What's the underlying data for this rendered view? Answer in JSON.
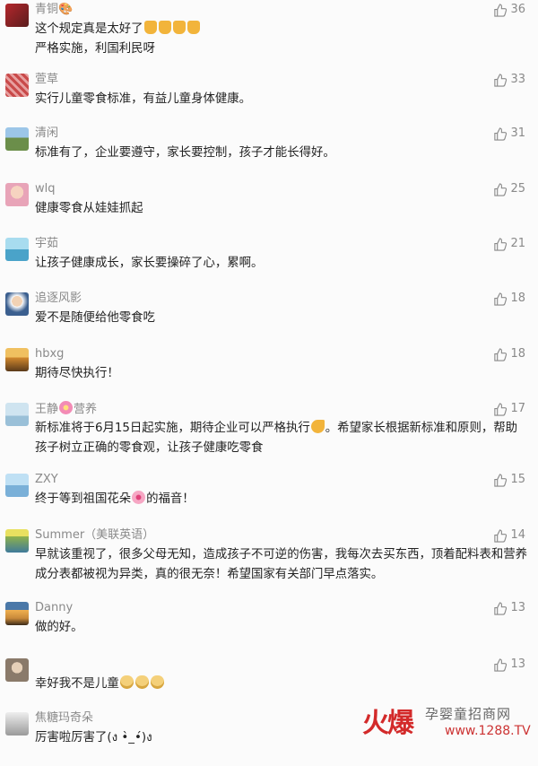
{
  "comments": [
    {
      "name": "青铜🎨",
      "text": "这个规定真是太好了",
      "emojis_after": [
        "thumbs-up-icon",
        "thumbs-up-icon",
        "thumbs-up-icon",
        "thumbs-up-icon"
      ],
      "text2": "严格实施，利国利民呀",
      "likes": "36",
      "avatar_color": "#b5272c"
    },
    {
      "name": "萱草",
      "text": "实行儿童零食标准，有益儿童身体健康。",
      "likes": "33",
      "avatar_color": "#c94a4a"
    },
    {
      "name": "清闲",
      "text": "标准有了，企业要遵守，家长要控制，孩子才能长得好。",
      "likes": "31",
      "avatar_color": "#6b8e4a"
    },
    {
      "name": "wlq",
      "text": "健康零食从娃娃抓起",
      "likes": "25",
      "avatar_color": "#e8a4b8"
    },
    {
      "name": "宇茹",
      "text": "让孩子健康成长，家长要操碎了心，累啊。",
      "likes": "21",
      "avatar_color": "#4aa3c9"
    },
    {
      "name": "追逐风影",
      "text": "爱不是随便给他零食吃",
      "likes": "18",
      "avatar_color": "#3b5f8f"
    },
    {
      "name": "hbxg",
      "text": "期待尽快执行！",
      "likes": "18",
      "avatar_color": "#d48a2e"
    },
    {
      "name": "王静",
      "name_suffix": "营养",
      "text": "新标准将于6月15日起实施，期待企业可以严格执行",
      "text2": "。希望家长根据新标准和原则，帮助孩子树立正确的零食观，让孩子健康吃零食",
      "likes": "17",
      "avatar_color": "#9ac0d8"
    },
    {
      "name": "ZXY",
      "text": "终于等到祖国花朵",
      "text2": "的福音！",
      "likes": "15",
      "avatar_color": "#7ab0d8"
    },
    {
      "name": "Summer（美联英语）",
      "text": "早就该重视了，很多父母无知，造成孩子不可逆的伤害，我每次去买东西，顶着配料表和营养成分表都被视为异类，真的很无奈！希望国家有关部门早点落实。",
      "likes": "14",
      "avatar_color": "#8fb24a"
    },
    {
      "name": "Danny",
      "text": "做的好。",
      "likes": "13",
      "avatar_color": "#c98a3a"
    },
    {
      "name": "",
      "text": "幸好我不是儿童",
      "likes": "13",
      "avatar_color": "#8a7a6a"
    },
    {
      "name": "焦糖玛奇朵",
      "text": "厉害啦厉害了(ง •̀_•́)ง",
      "likes": "",
      "avatar_color": "#9a9a9a"
    }
  ],
  "watermark": {
    "brand": "火爆",
    "site": "孕婴童招商网",
    "url": "www.1288.TV"
  }
}
